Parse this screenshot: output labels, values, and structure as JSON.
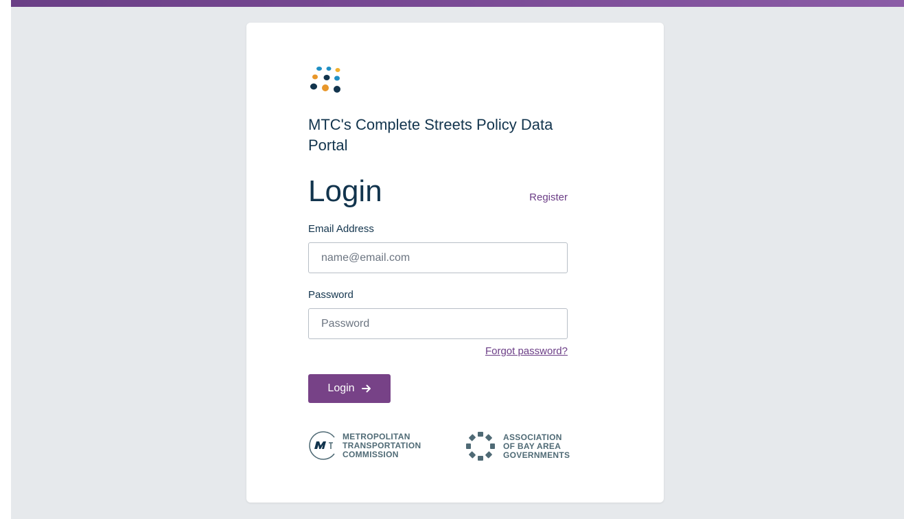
{
  "header": {
    "portal_title": "MTC's Complete Streets Policy Data Portal"
  },
  "login": {
    "heading": "Login",
    "register_link": "Register",
    "email_label": "Email Address",
    "email_placeholder": "name@email.com",
    "password_label": "Password",
    "password_placeholder": "Password",
    "forgot_link": "Forgot password?",
    "submit_label": "Login",
    "submit_icon": "arrow-right-icon"
  },
  "footer": {
    "mtc_logo_lines": [
      "METROPOLITAN",
      "TRANSPORTATION",
      "COMMISSION"
    ],
    "abag_logo_lines": [
      "ASSOCIATION",
      "OF BAY AREA",
      "GOVERNMENTS"
    ]
  },
  "colors": {
    "accent_purple": "#774287",
    "heading_navy": "#12344d",
    "background": "#e6e9ec",
    "logo_dot_blue": "#1f8fc4",
    "logo_dot_orange": "#e8972a",
    "logo_dot_navy": "#12344d",
    "logo_dot_yellow": "#f0b030"
  }
}
